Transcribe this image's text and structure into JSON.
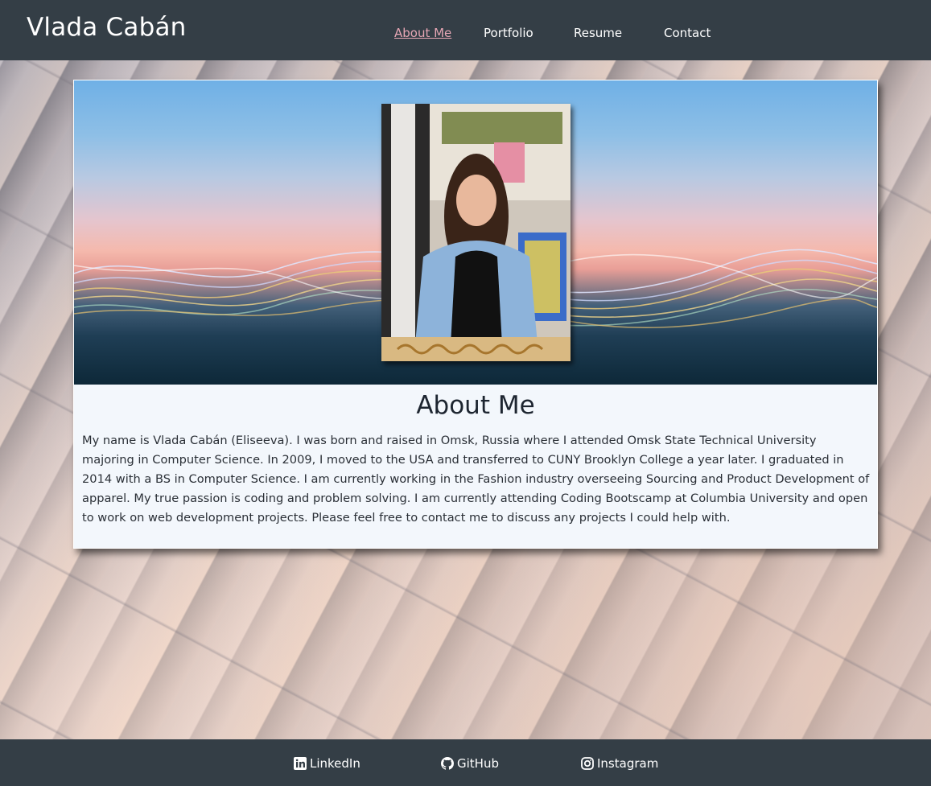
{
  "header": {
    "brand": "Vlada Cabán",
    "nav": [
      {
        "label": "About Me",
        "active": true
      },
      {
        "label": "Portfolio",
        "active": false
      },
      {
        "label": "Resume",
        "active": false
      },
      {
        "label": "Contact",
        "active": false
      }
    ]
  },
  "about": {
    "title": "About Me",
    "body": "My name is Vlada Cabán (Eliseeva). I was born and raised in Omsk, Russia where I attended Omsk State Technical University majoring in Computer Science. In 2009, I moved to the USA and transferred to CUNY Brooklyn College a year later. I graduated in 2014 with a BS in Computer Science. I am currently working in the Fashion industry overseeing Sourcing and Product Development of apparel. My true passion is coding and problem solving. I am currently attending Coding Bootscamp at Columbia University and open to work on web development projects. Please feel free to contact me to discuss any projects I could help with."
  },
  "footer": {
    "links": [
      {
        "label": "LinkedIn",
        "icon": "linkedin-icon"
      },
      {
        "label": "GitHub",
        "icon": "github-icon"
      },
      {
        "label": "Instagram",
        "icon": "instagram-icon"
      }
    ]
  },
  "colors": {
    "header_bg": "#343e46",
    "nav_active": "#e6a6b4",
    "card_bg": "#f3f7fc"
  }
}
